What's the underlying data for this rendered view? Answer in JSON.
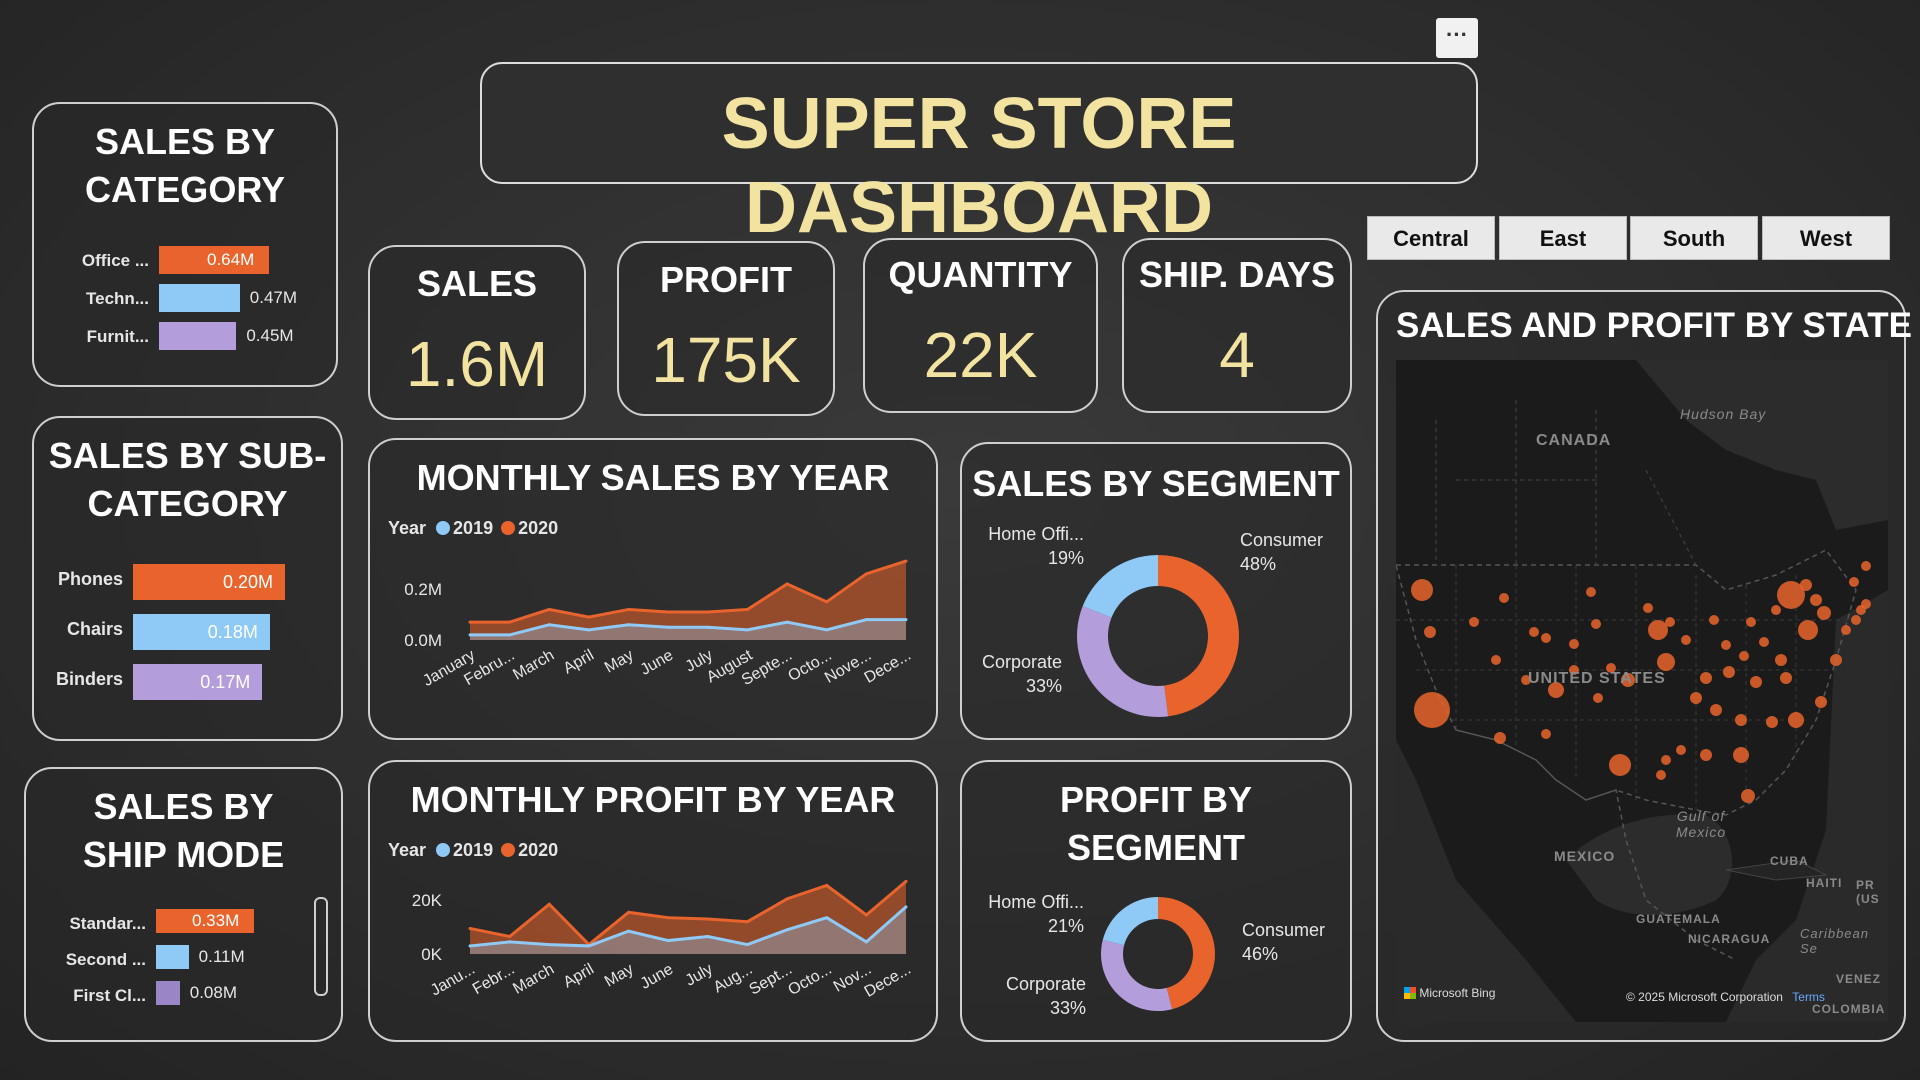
{
  "header": {
    "title": "SUPER STORE DASHBOARD",
    "more_label": "···"
  },
  "kpis": [
    {
      "label": "SALES",
      "value": "1.6M"
    },
    {
      "label": "PROFIT",
      "value": "175K"
    },
    {
      "label": "QUANTITY",
      "value": "22K"
    },
    {
      "label": "SHIP. DAYS",
      "value": "4"
    }
  ],
  "region_slicer": [
    "Central",
    "East",
    "South",
    "West"
  ],
  "colors": {
    "orange": "#e8642c",
    "blue": "#8fc9f5",
    "purple": "#b39ddb",
    "gold": "#f2e3a1",
    "grey_purple": "#9a86c6"
  },
  "sales_by_category": {
    "title": "SALES BY CATEGORY",
    "rows": [
      {
        "label": "Office ...",
        "value": 0.64,
        "value_label": "0.64M",
        "color": "#e8642c"
      },
      {
        "label": "Techn...",
        "value": 0.47,
        "value_label": "0.47M",
        "color": "#8fc9f5"
      },
      {
        "label": "Furnit...",
        "value": 0.45,
        "value_label": "0.45M",
        "color": "#b39ddb"
      }
    ]
  },
  "sales_by_subcategory": {
    "title": "SALES BY SUB-CATEGORY",
    "rows": [
      {
        "label": "Phones",
        "value": 0.2,
        "value_label": "0.20M",
        "color": "#e8642c"
      },
      {
        "label": "Chairs",
        "value": 0.18,
        "value_label": "0.18M",
        "color": "#8fc9f5"
      },
      {
        "label": "Binders",
        "value": 0.17,
        "value_label": "0.17M",
        "color": "#b39ddb"
      }
    ]
  },
  "sales_by_shipmode": {
    "title": "SALES BY SHIP MODE",
    "rows": [
      {
        "label": "Standar...",
        "value": 0.33,
        "value_label": "0.33M",
        "color": "#e8642c"
      },
      {
        "label": "Second ...",
        "value": 0.11,
        "value_label": "0.11M",
        "color": "#8fc9f5"
      },
      {
        "label": "First Cl...",
        "value": 0.08,
        "value_label": "0.08M",
        "color": "#9a86c6"
      }
    ]
  },
  "chart_data": [
    {
      "type": "area",
      "title": "MONTHLY SALES BY YEAR",
      "legend_title": "Year",
      "categories": [
        "January",
        "Febru...",
        "March",
        "April",
        "May",
        "June",
        "July",
        "August",
        "Septe...",
        "Octo...",
        "Nove...",
        "Dece..."
      ],
      "series": [
        {
          "name": "2019",
          "values": [
            0.02,
            0.02,
            0.06,
            0.04,
            0.06,
            0.05,
            0.05,
            0.04,
            0.07,
            0.04,
            0.08,
            0.08
          ]
        },
        {
          "name": "2020",
          "values": [
            0.07,
            0.07,
            0.12,
            0.09,
            0.12,
            0.11,
            0.11,
            0.12,
            0.22,
            0.15,
            0.26,
            0.31
          ]
        }
      ],
      "yticks": [
        "0.0M",
        "0.2M"
      ],
      "ytick_values": [
        0,
        0.2
      ],
      "ylim": [
        0,
        0.33
      ]
    },
    {
      "type": "area",
      "title": "MONTHLY PROFIT BY YEAR",
      "legend_title": "Year",
      "categories": [
        "Janu...",
        "Febr...",
        "March",
        "April",
        "May",
        "June",
        "July",
        "Aug...",
        "Sept...",
        "Octo...",
        "Nov...",
        "Dece..."
      ],
      "series": [
        {
          "name": "2019",
          "values": [
            3000,
            4500,
            3500,
            3000,
            8500,
            5000,
            6500,
            3500,
            9000,
            13500,
            4500,
            17500
          ]
        },
        {
          "name": "2020",
          "values": [
            9500,
            6500,
            18500,
            3500,
            15500,
            13500,
            13000,
            12000,
            20500,
            25500,
            14500,
            27000
          ]
        }
      ],
      "yticks": [
        "0K",
        "20K"
      ],
      "ytick_values": [
        0,
        20000
      ],
      "ylim": [
        0,
        29000
      ]
    },
    {
      "type": "pie",
      "title": "SALES BY SEGMENT",
      "slices": [
        {
          "label": "Consumer",
          "pct_label": "48%",
          "value": 48
        },
        {
          "label": "Corporate",
          "pct_label": "33%",
          "value": 33
        },
        {
          "label": "Home Offi...",
          "pct_label": "19%",
          "value": 19
        }
      ]
    },
    {
      "type": "pie",
      "title": "PROFIT BY SEGMENT",
      "slices": [
        {
          "label": "Consumer",
          "pct_label": "46%",
          "value": 46
        },
        {
          "label": "Corporate",
          "pct_label": "33%",
          "value": 33
        },
        {
          "label": "Home Offi...",
          "pct_label": "21%",
          "value": 21
        }
      ]
    }
  ],
  "map": {
    "title": "SALES AND PROFIT BY STATE",
    "labels": {
      "canada": "CANADA",
      "hudson": "Hudson Bay",
      "usa": "UNITED STATES",
      "mexico": "MEXICO",
      "gulf": "Gulf of Mexico",
      "cuba": "CUBA",
      "haiti": "HAITI",
      "guatemala": "GUATEMALA",
      "nicaragua": "NICARAGUA",
      "caribbean": "Caribbean Se",
      "venez": "VENEZ",
      "colombia": "COLOMBIA",
      "pr": "PR (US"
    },
    "bing": "Microsoft Bing",
    "copyright": "© 2025 Microsoft Corporation",
    "terms": "Terms"
  }
}
